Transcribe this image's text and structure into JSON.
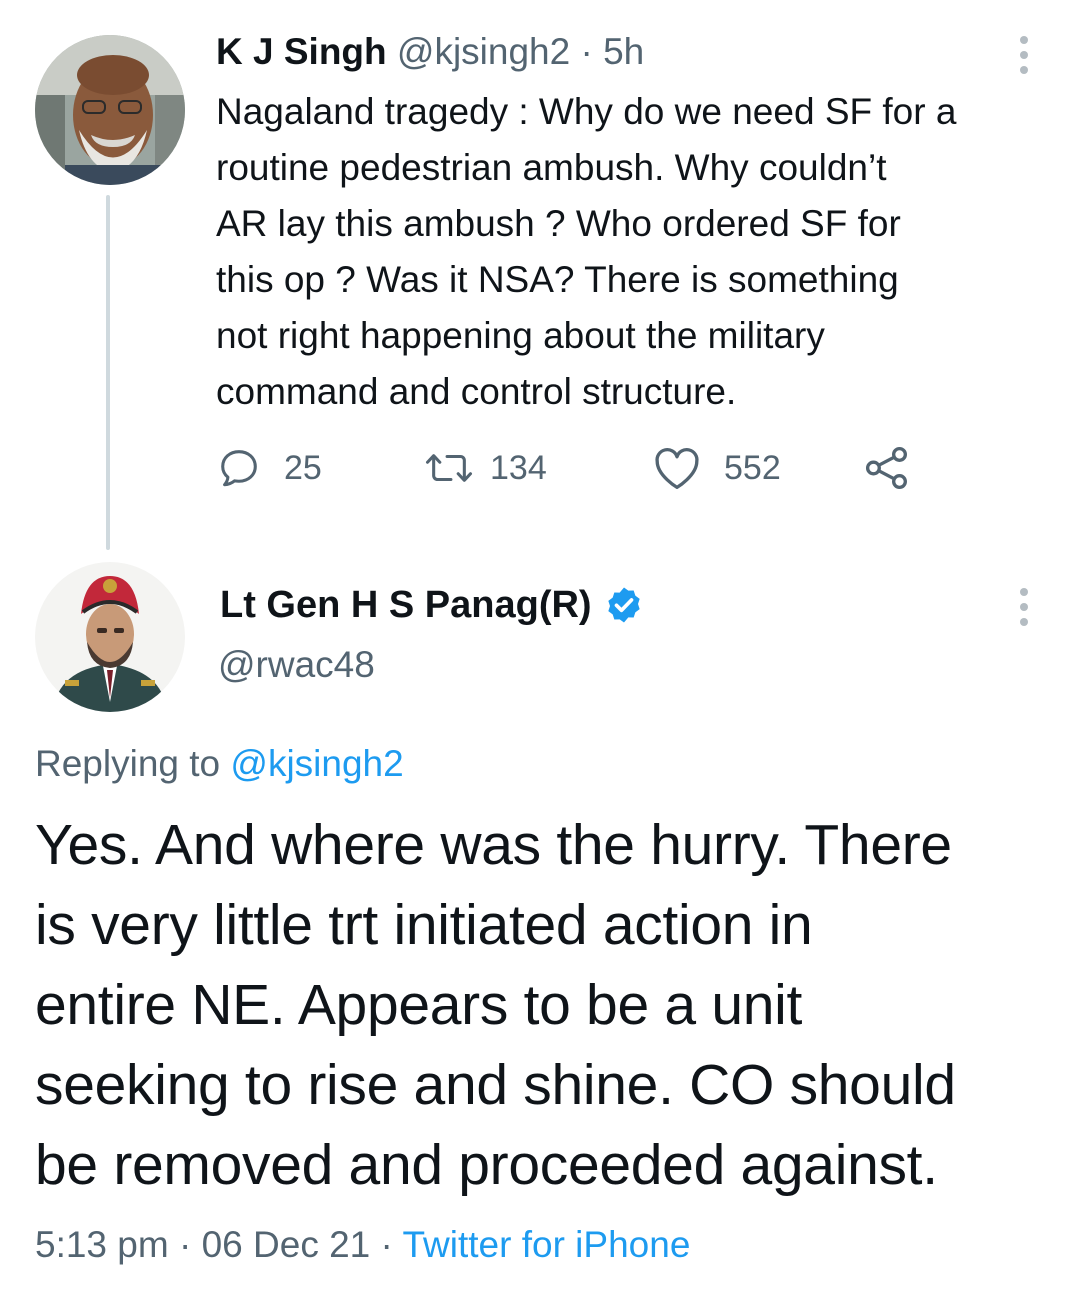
{
  "tweet1": {
    "name": "K J Singh",
    "handle": "@kjsingh2",
    "separator": "·",
    "time": "5h",
    "body": "Nagaland tragedy : Why do we need SF for a\nroutine pedestrian ambush. Why couldn’t\nAR lay this ambush ? Who ordered SF for\nthis op ? Was it NSA? There is something\nnot right happening about the military\ncommand and control structure.",
    "replies": "25",
    "retweets": "134",
    "likes": "552",
    "icons": [
      "reply-icon",
      "retweet-icon",
      "like-icon",
      "share-icon",
      "more-icon"
    ]
  },
  "tweet2": {
    "name": "Lt Gen H S Panag(R)",
    "handle": "@rwac48",
    "replying_prefix": "Replying to ",
    "replying_to": "@kjsingh2",
    "body": "Yes. And where was the hurry. There\nis very little trt initiated action in\nentire NE. Appears to be a unit\nseeking to rise and shine. CO should\nbe removed and proceeded against.",
    "time": "5:13 pm",
    "sep1": " · ",
    "date": "06 Dec 21",
    "sep2": " · ",
    "source": "Twitter for iPhone"
  },
  "colors": {
    "text": "#0f1419",
    "muted": "#536471",
    "link": "#1d9bf0",
    "thread_line": "#cfd9de"
  }
}
